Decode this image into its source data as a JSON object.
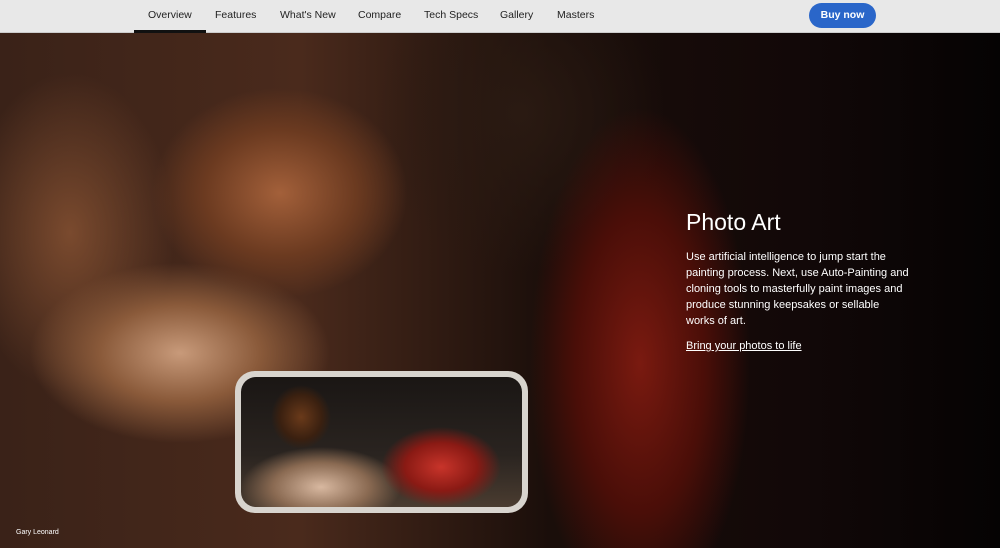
{
  "nav": {
    "items": [
      "Overview",
      "Features",
      "What's New",
      "Compare",
      "Tech Specs",
      "Gallery",
      "Masters"
    ],
    "active": "Overview",
    "buy_label": "Buy now"
  },
  "hero": {
    "title": "Photo Art",
    "body": "Use artificial intelligence to jump start the painting process. Next, use Auto-Painting and cloning tools to masterfully paint images and produce stunning keepsakes or sellable works of art.",
    "link": "Bring your photos to life",
    "credit": "Gary Leonard"
  },
  "colors": {
    "accent": "#2a66c9"
  }
}
